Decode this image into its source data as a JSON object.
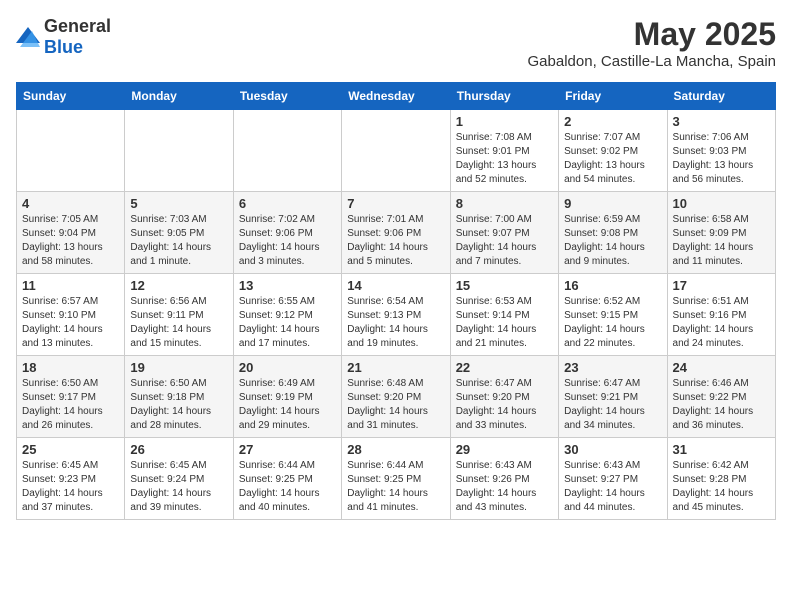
{
  "header": {
    "logo_general": "General",
    "logo_blue": "Blue",
    "title": "May 2025",
    "subtitle": "Gabaldon, Castille-La Mancha, Spain"
  },
  "calendar": {
    "days_of_week": [
      "Sunday",
      "Monday",
      "Tuesday",
      "Wednesday",
      "Thursday",
      "Friday",
      "Saturday"
    ],
    "weeks": [
      [
        {
          "day": "",
          "sunrise": "",
          "sunset": "",
          "daylight": ""
        },
        {
          "day": "",
          "sunrise": "",
          "sunset": "",
          "daylight": ""
        },
        {
          "day": "",
          "sunrise": "",
          "sunset": "",
          "daylight": ""
        },
        {
          "day": "",
          "sunrise": "",
          "sunset": "",
          "daylight": ""
        },
        {
          "day": "1",
          "sunrise": "Sunrise: 7:08 AM",
          "sunset": "Sunset: 9:01 PM",
          "daylight": "Daylight: 13 hours and 52 minutes."
        },
        {
          "day": "2",
          "sunrise": "Sunrise: 7:07 AM",
          "sunset": "Sunset: 9:02 PM",
          "daylight": "Daylight: 13 hours and 54 minutes."
        },
        {
          "day": "3",
          "sunrise": "Sunrise: 7:06 AM",
          "sunset": "Sunset: 9:03 PM",
          "daylight": "Daylight: 13 hours and 56 minutes."
        }
      ],
      [
        {
          "day": "4",
          "sunrise": "Sunrise: 7:05 AM",
          "sunset": "Sunset: 9:04 PM",
          "daylight": "Daylight: 13 hours and 58 minutes."
        },
        {
          "day": "5",
          "sunrise": "Sunrise: 7:03 AM",
          "sunset": "Sunset: 9:05 PM",
          "daylight": "Daylight: 14 hours and 1 minute."
        },
        {
          "day": "6",
          "sunrise": "Sunrise: 7:02 AM",
          "sunset": "Sunset: 9:06 PM",
          "daylight": "Daylight: 14 hours and 3 minutes."
        },
        {
          "day": "7",
          "sunrise": "Sunrise: 7:01 AM",
          "sunset": "Sunset: 9:06 PM",
          "daylight": "Daylight: 14 hours and 5 minutes."
        },
        {
          "day": "8",
          "sunrise": "Sunrise: 7:00 AM",
          "sunset": "Sunset: 9:07 PM",
          "daylight": "Daylight: 14 hours and 7 minutes."
        },
        {
          "day": "9",
          "sunrise": "Sunrise: 6:59 AM",
          "sunset": "Sunset: 9:08 PM",
          "daylight": "Daylight: 14 hours and 9 minutes."
        },
        {
          "day": "10",
          "sunrise": "Sunrise: 6:58 AM",
          "sunset": "Sunset: 9:09 PM",
          "daylight": "Daylight: 14 hours and 11 minutes."
        }
      ],
      [
        {
          "day": "11",
          "sunrise": "Sunrise: 6:57 AM",
          "sunset": "Sunset: 9:10 PM",
          "daylight": "Daylight: 14 hours and 13 minutes."
        },
        {
          "day": "12",
          "sunrise": "Sunrise: 6:56 AM",
          "sunset": "Sunset: 9:11 PM",
          "daylight": "Daylight: 14 hours and 15 minutes."
        },
        {
          "day": "13",
          "sunrise": "Sunrise: 6:55 AM",
          "sunset": "Sunset: 9:12 PM",
          "daylight": "Daylight: 14 hours and 17 minutes."
        },
        {
          "day": "14",
          "sunrise": "Sunrise: 6:54 AM",
          "sunset": "Sunset: 9:13 PM",
          "daylight": "Daylight: 14 hours and 19 minutes."
        },
        {
          "day": "15",
          "sunrise": "Sunrise: 6:53 AM",
          "sunset": "Sunset: 9:14 PM",
          "daylight": "Daylight: 14 hours and 21 minutes."
        },
        {
          "day": "16",
          "sunrise": "Sunrise: 6:52 AM",
          "sunset": "Sunset: 9:15 PM",
          "daylight": "Daylight: 14 hours and 22 minutes."
        },
        {
          "day": "17",
          "sunrise": "Sunrise: 6:51 AM",
          "sunset": "Sunset: 9:16 PM",
          "daylight": "Daylight: 14 hours and 24 minutes."
        }
      ],
      [
        {
          "day": "18",
          "sunrise": "Sunrise: 6:50 AM",
          "sunset": "Sunset: 9:17 PM",
          "daylight": "Daylight: 14 hours and 26 minutes."
        },
        {
          "day": "19",
          "sunrise": "Sunrise: 6:50 AM",
          "sunset": "Sunset: 9:18 PM",
          "daylight": "Daylight: 14 hours and 28 minutes."
        },
        {
          "day": "20",
          "sunrise": "Sunrise: 6:49 AM",
          "sunset": "Sunset: 9:19 PM",
          "daylight": "Daylight: 14 hours and 29 minutes."
        },
        {
          "day": "21",
          "sunrise": "Sunrise: 6:48 AM",
          "sunset": "Sunset: 9:20 PM",
          "daylight": "Daylight: 14 hours and 31 minutes."
        },
        {
          "day": "22",
          "sunrise": "Sunrise: 6:47 AM",
          "sunset": "Sunset: 9:20 PM",
          "daylight": "Daylight: 14 hours and 33 minutes."
        },
        {
          "day": "23",
          "sunrise": "Sunrise: 6:47 AM",
          "sunset": "Sunset: 9:21 PM",
          "daylight": "Daylight: 14 hours and 34 minutes."
        },
        {
          "day": "24",
          "sunrise": "Sunrise: 6:46 AM",
          "sunset": "Sunset: 9:22 PM",
          "daylight": "Daylight: 14 hours and 36 minutes."
        }
      ],
      [
        {
          "day": "25",
          "sunrise": "Sunrise: 6:45 AM",
          "sunset": "Sunset: 9:23 PM",
          "daylight": "Daylight: 14 hours and 37 minutes."
        },
        {
          "day": "26",
          "sunrise": "Sunrise: 6:45 AM",
          "sunset": "Sunset: 9:24 PM",
          "daylight": "Daylight: 14 hours and 39 minutes."
        },
        {
          "day": "27",
          "sunrise": "Sunrise: 6:44 AM",
          "sunset": "Sunset: 9:25 PM",
          "daylight": "Daylight: 14 hours and 40 minutes."
        },
        {
          "day": "28",
          "sunrise": "Sunrise: 6:44 AM",
          "sunset": "Sunset: 9:25 PM",
          "daylight": "Daylight: 14 hours and 41 minutes."
        },
        {
          "day": "29",
          "sunrise": "Sunrise: 6:43 AM",
          "sunset": "Sunset: 9:26 PM",
          "daylight": "Daylight: 14 hours and 43 minutes."
        },
        {
          "day": "30",
          "sunrise": "Sunrise: 6:43 AM",
          "sunset": "Sunset: 9:27 PM",
          "daylight": "Daylight: 14 hours and 44 minutes."
        },
        {
          "day": "31",
          "sunrise": "Sunrise: 6:42 AM",
          "sunset": "Sunset: 9:28 PM",
          "daylight": "Daylight: 14 hours and 45 minutes."
        }
      ]
    ]
  }
}
